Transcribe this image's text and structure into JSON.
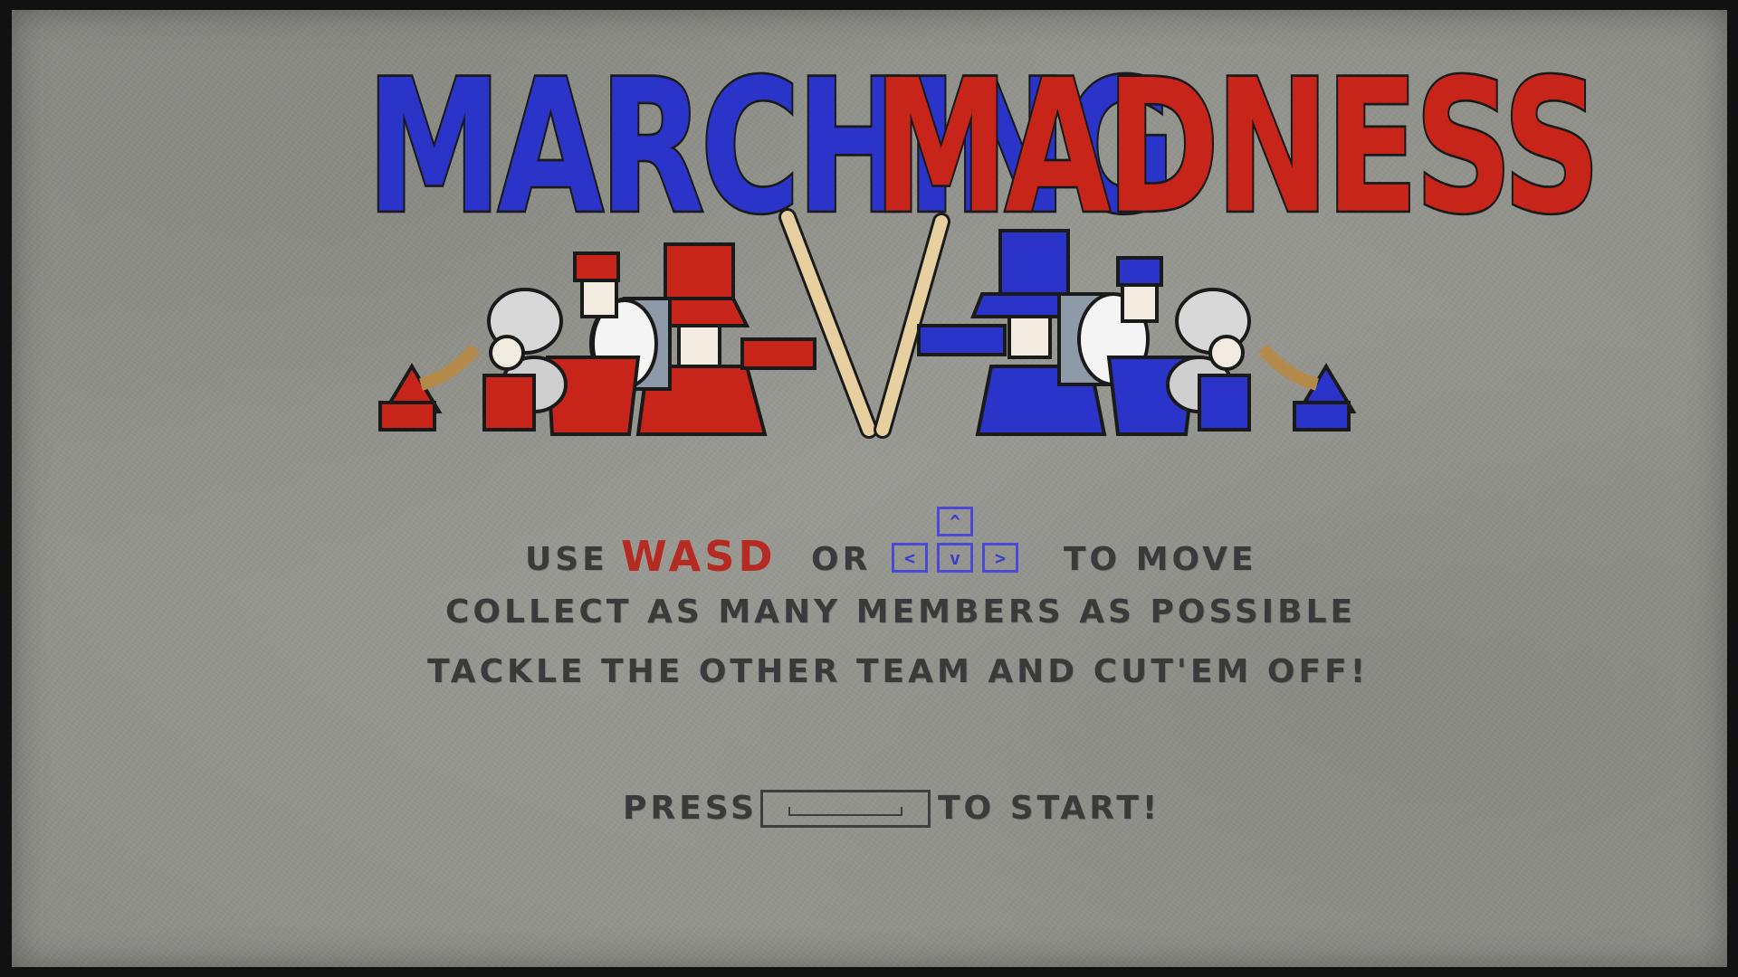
{
  "title": {
    "word1": "MARCHING",
    "word2": "MADNESS"
  },
  "colors": {
    "blue_team": "#2a34c8",
    "red_team": "#c8251a",
    "text": "#3a3a3a",
    "background": "#969690"
  },
  "instructions": {
    "line1_prefix": "USE",
    "wasd": "WASD",
    "or": "OR",
    "to_move": "TO MOVE",
    "line2": "COLLECT AS MANY MEMBERS AS POSSIBLE",
    "line3": "TACKLE THE OTHER TEAM AND CUT'EM OFF!"
  },
  "arrow_keys": {
    "up": "^",
    "left": "<",
    "down": "v",
    "right": ">"
  },
  "start": {
    "press": "PRESS",
    "to_start": "TO START!"
  }
}
